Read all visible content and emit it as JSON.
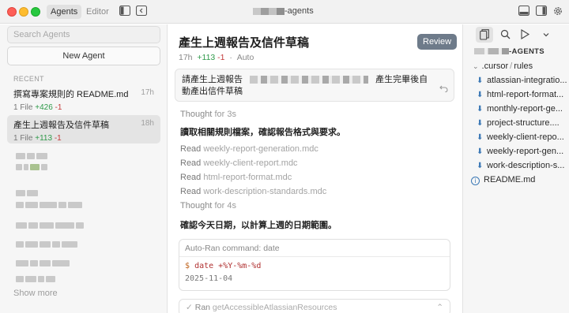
{
  "titlebar": {
    "tabs": [
      "Agents",
      "Editor"
    ],
    "window_title": "-agents"
  },
  "sidebar": {
    "search_placeholder": "Search Agents",
    "new_agent_label": "New Agent",
    "section_label": "RECENT",
    "items": [
      {
        "title": "撰寫專案規則的 README.md",
        "time": "17h",
        "files": "1 File",
        "additions": "+426",
        "deletions": "-1"
      },
      {
        "title": "產生上週報告及信件草稿",
        "time": "18h",
        "files": "1 File",
        "additions": "+113",
        "deletions": "-1"
      }
    ],
    "show_more_label": "Show more"
  },
  "main": {
    "title": "產生上週報告及信件草稿",
    "review_label": "Review",
    "meta": {
      "time": "17h",
      "additions": "+113",
      "deletions": "-1",
      "mode": "Auto"
    },
    "prompt": {
      "line1_start": "請產生上週報告",
      "line1_end": "產生完畢後自",
      "line2": "動產出信件草稿"
    },
    "thought1": {
      "label": "Thought",
      "duration": "for 3s"
    },
    "step1": "讀取相關規則檔案，確認報告格式與要求。",
    "reads": [
      {
        "verb": "Read",
        "file": "weekly-report-generation.mdc"
      },
      {
        "verb": "Read",
        "file": "weekly-client-report.mdc"
      },
      {
        "verb": "Read",
        "file": "html-report-format.mdc"
      },
      {
        "verb": "Read",
        "file": "work-description-standards.mdc"
      }
    ],
    "thought2": {
      "label": "Thought",
      "duration": "for 4s"
    },
    "step2": "確認今天日期，以計算上週的日期範圍。",
    "command": {
      "header": "Auto-Ran command: date",
      "prompt_symbol": "$",
      "command_text": "date +%Y-%m-%d",
      "output": "2025-11-04"
    },
    "ran": {
      "label": "Ran",
      "function": "getAccessibleAtlassianResources"
    }
  },
  "file_tree": {
    "project_suffix": "-AGENTS",
    "folder": ".cursor",
    "subfolder": "rules",
    "files": [
      "atlassian-integratio...",
      "html-report-format...",
      "monthly-report-ge...",
      "project-structure....",
      "weekly-client-repo...",
      "weekly-report-gen...",
      "work-description-s..."
    ],
    "readme": "README.md"
  }
}
